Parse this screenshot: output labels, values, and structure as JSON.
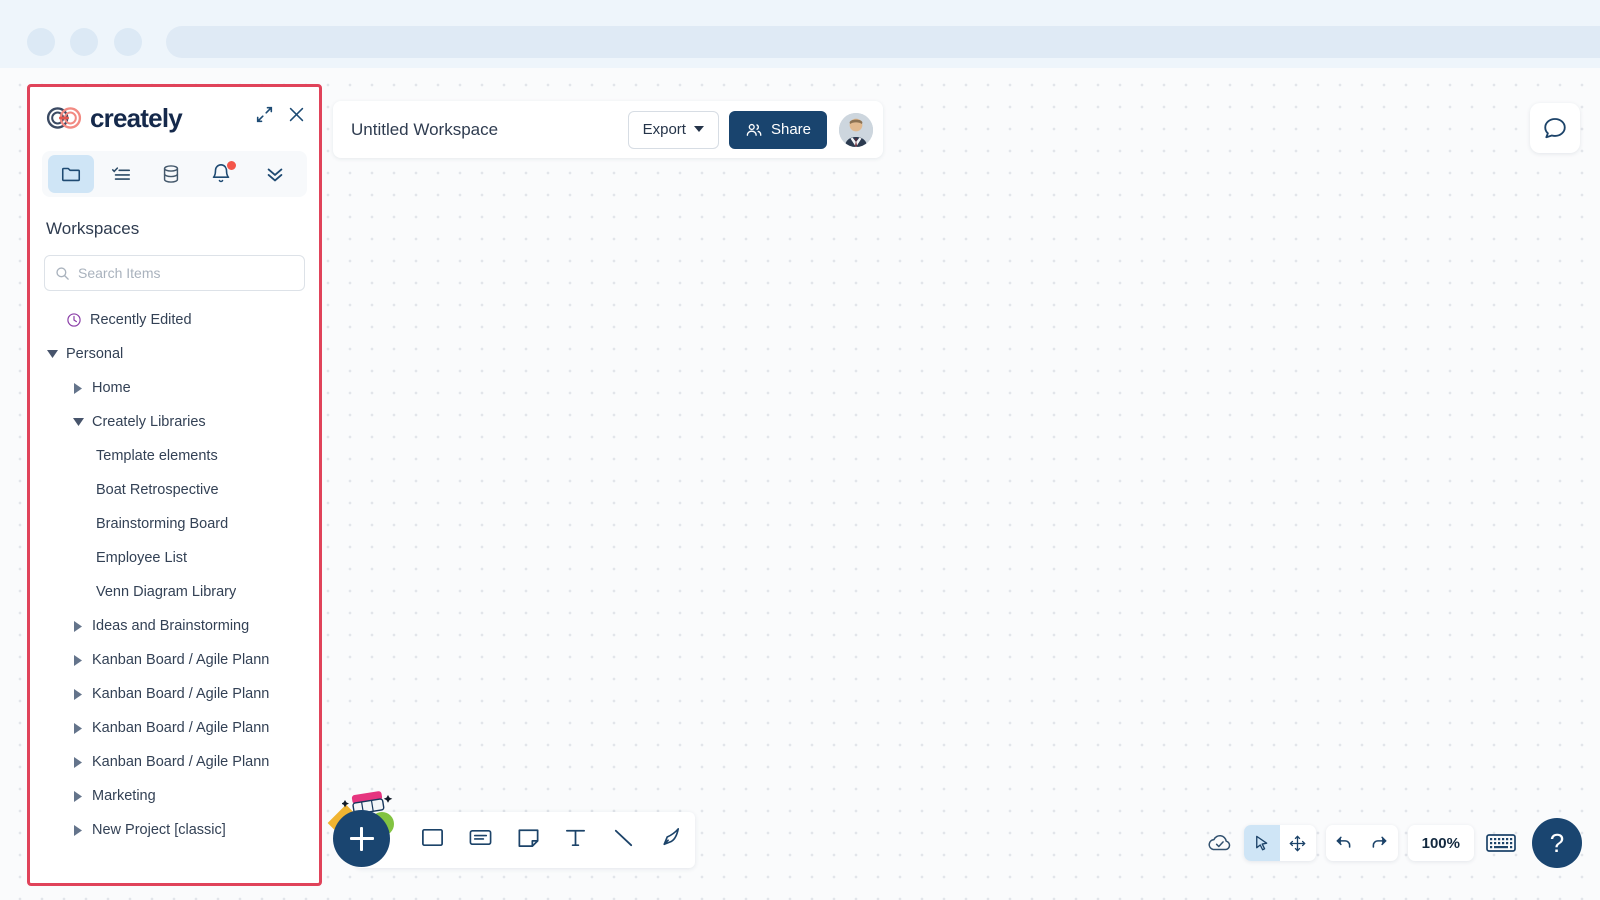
{
  "browser": {
    "dots": [
      "nav-dot-1",
      "nav-dot-2",
      "nav-dot-3"
    ],
    "urlbar_value": ""
  },
  "panel": {
    "brand": "creately",
    "expand_icon": "expand-icon",
    "close_icon": "close-icon",
    "tabs": [
      {
        "name": "folder-tab",
        "icon": "folder-icon",
        "active": true,
        "badge": false
      },
      {
        "name": "checklist-tab",
        "icon": "checklist-icon",
        "active": false,
        "badge": false
      },
      {
        "name": "database-tab",
        "icon": "database-icon",
        "active": false,
        "badge": false
      },
      {
        "name": "notifications-tab",
        "icon": "bell-icon",
        "active": false,
        "badge": true
      },
      {
        "name": "more-tab",
        "icon": "chevron-double-down-icon",
        "active": false,
        "badge": false
      }
    ],
    "title": "Workspaces",
    "search": {
      "placeholder": "Search Items",
      "value": "",
      "icon": "search-icon"
    },
    "tree": [
      {
        "label": "Recently Edited",
        "level": 0,
        "caret": "none",
        "icon": "clock-icon"
      },
      {
        "label": "Personal",
        "level": 0,
        "caret": "expanded",
        "icon": ""
      },
      {
        "label": "Home",
        "level": 1,
        "caret": "collapsed",
        "icon": ""
      },
      {
        "label": "Creately Libraries",
        "level": 1,
        "caret": "expanded",
        "icon": ""
      },
      {
        "label": "Template elements",
        "level": 2,
        "caret": "none",
        "icon": ""
      },
      {
        "label": "Boat Retrospective",
        "level": 2,
        "caret": "none",
        "icon": ""
      },
      {
        "label": "Brainstorming Board",
        "level": 2,
        "caret": "none",
        "icon": ""
      },
      {
        "label": "Employee List",
        "level": 2,
        "caret": "none",
        "icon": ""
      },
      {
        "label": "Venn Diagram Library",
        "level": 2,
        "caret": "none",
        "icon": ""
      },
      {
        "label": "Ideas and Brainstorming",
        "level": 1,
        "caret": "collapsed",
        "icon": ""
      },
      {
        "label": "Kanban Board / Agile Plann",
        "level": 1,
        "caret": "collapsed",
        "icon": ""
      },
      {
        "label": "Kanban Board / Agile Plann",
        "level": 1,
        "caret": "collapsed",
        "icon": ""
      },
      {
        "label": "Kanban Board / Agile Plann",
        "level": 1,
        "caret": "collapsed",
        "icon": ""
      },
      {
        "label": "Kanban Board / Agile Plann",
        "level": 1,
        "caret": "collapsed",
        "icon": ""
      },
      {
        "label": "Marketing",
        "level": 1,
        "caret": "collapsed",
        "icon": ""
      },
      {
        "label": "New Project [classic]",
        "level": 1,
        "caret": "collapsed",
        "icon": ""
      }
    ]
  },
  "topbar": {
    "workspace_name": "Untitled Workspace",
    "export_label": "Export",
    "export_caret_icon": "caret-down-icon",
    "share_label": "Share",
    "share_icon": "people-icon",
    "avatar_name": "user-avatar"
  },
  "comment": {
    "icon": "comment-bubble-icon"
  },
  "shapebar": {
    "add_button_icon": "plus-icon",
    "tools": [
      {
        "name": "rectangle-tool",
        "icon": "rectangle-icon"
      },
      {
        "name": "card-tool",
        "icon": "card-icon"
      },
      {
        "name": "note-tool",
        "icon": "sticky-note-icon"
      },
      {
        "name": "text-tool",
        "icon": "text-icon"
      },
      {
        "name": "line-tool",
        "icon": "line-icon"
      },
      {
        "name": "freehand-tool",
        "icon": "pen-icon"
      }
    ]
  },
  "bottom_right": {
    "sync_icon": "cloud-check-icon",
    "select_icon": "cursor-arrow-icon",
    "pan_icon": "move-arrows-icon",
    "undo_icon": "undo-icon",
    "redo_icon": "redo-icon",
    "zoom_level": "100%",
    "keyboard_icon": "keyboard-icon",
    "help_label": "?"
  },
  "colors": {
    "brand_navy": "#15294b",
    "brand_coral": "#f28a82",
    "accent_blue": "#19446e",
    "active_tab_bg": "#cfe5f6",
    "highlight_border": "#e0435a",
    "notification_red": "#f4564a",
    "clock_purple": "#8b3fa8",
    "canvas_bg": "#fafbfc",
    "chrome_bg": "#eef5fb"
  }
}
